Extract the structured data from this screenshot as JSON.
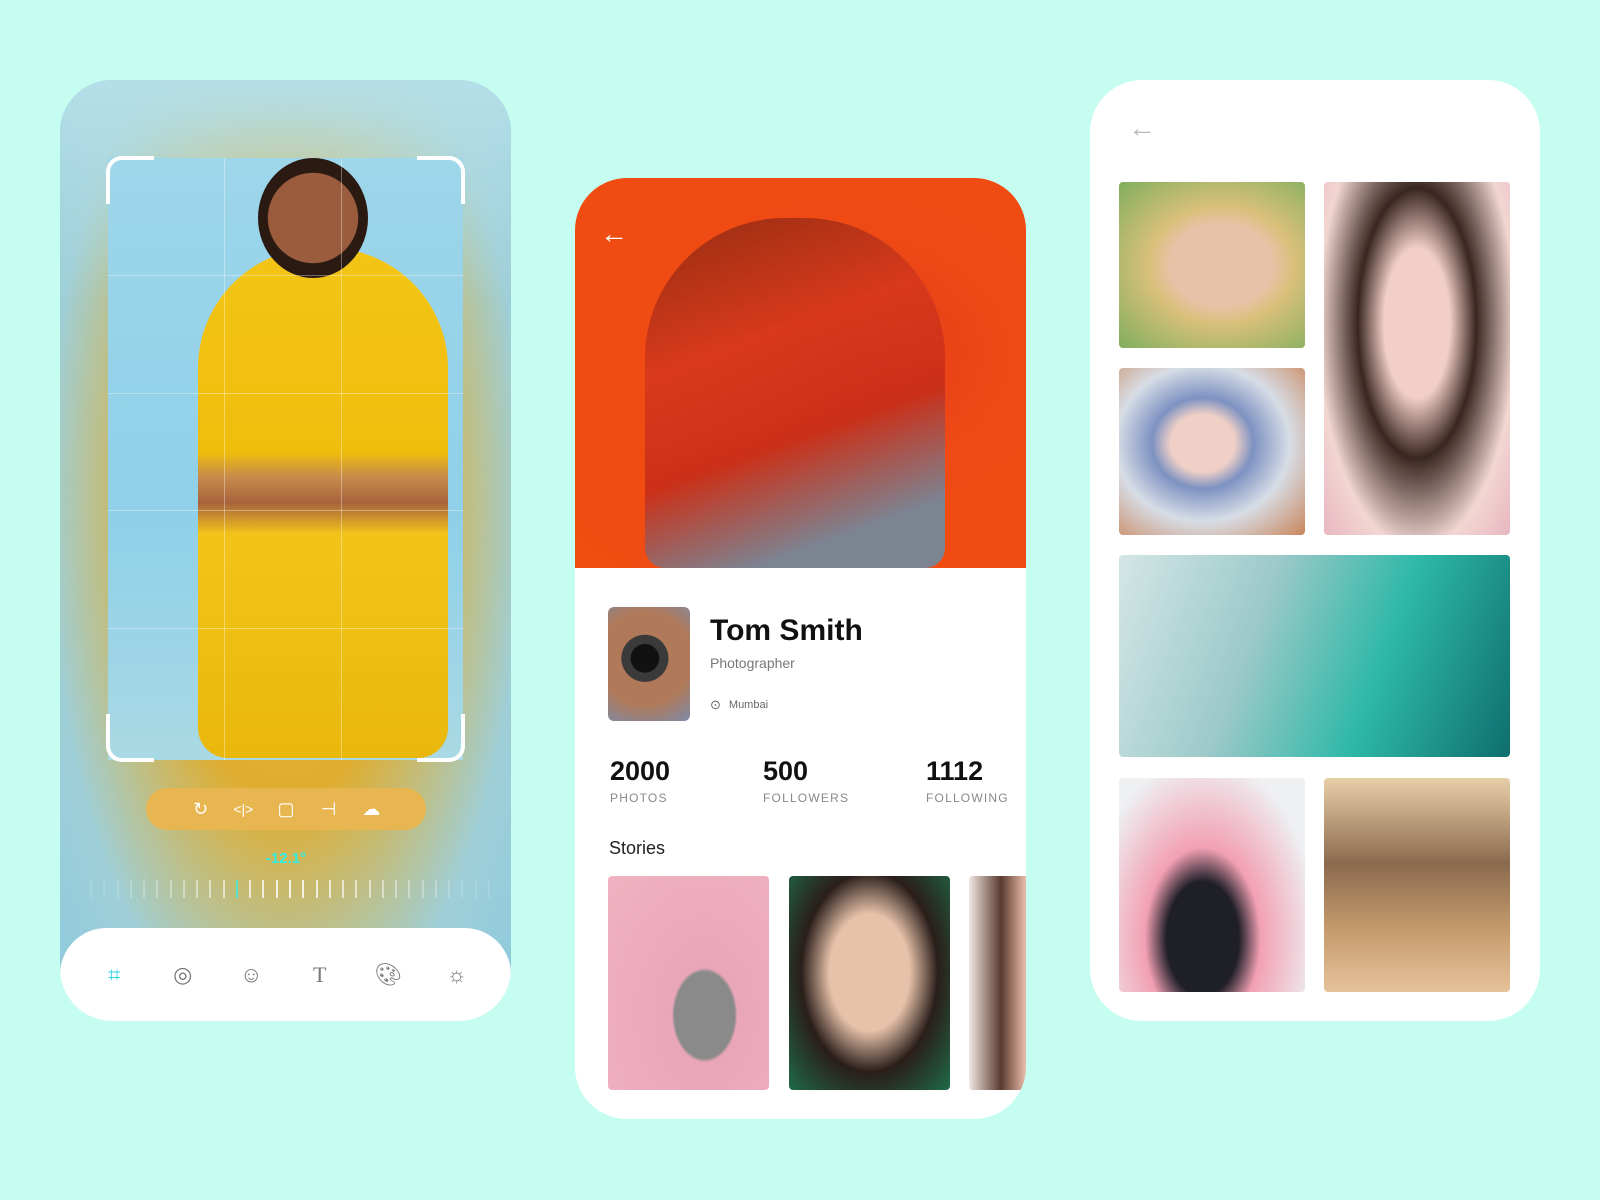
{
  "editor": {
    "toolbar_icons": [
      "rotate-icon",
      "flip-icon",
      "aspect-ratio-icon",
      "perspective-icon",
      "cloud-icon"
    ],
    "angle_value": "-12.1°",
    "bottom_tools": [
      "crop-icon",
      "filters-icon",
      "sticker-icon",
      "text-icon",
      "palette-icon",
      "brightness-icon"
    ],
    "active_tool": "crop-icon",
    "accent_color": "#2ef0e6"
  },
  "profile": {
    "name": "Tom Smith",
    "role": "Photographer",
    "location": "Mumbai",
    "stats": [
      {
        "value": "2000",
        "label": "PHOTOS"
      },
      {
        "value": "500",
        "label": "FOLLOWERS"
      },
      {
        "value": "1112",
        "label": "FOLLOWING"
      }
    ],
    "stories_title": "Stories"
  },
  "gallery": {}
}
